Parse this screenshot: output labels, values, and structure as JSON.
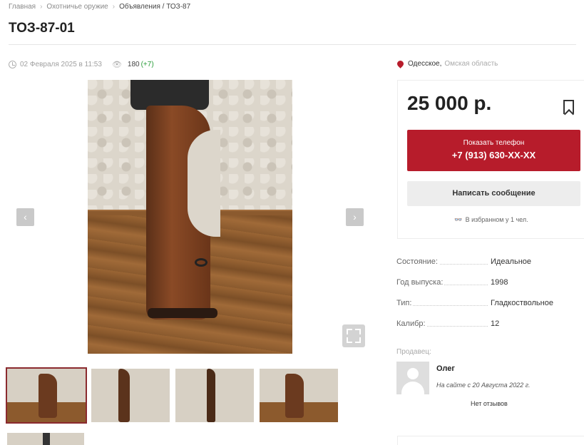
{
  "breadcrumbs": [
    "Главная",
    "Охотничье оружие",
    "Объявления / ТОЗ-87"
  ],
  "title": "ТОЗ-87-01",
  "meta": {
    "date": "02 Февраля 2025 в 11:53",
    "views": "180",
    "views_delta": "(+7)"
  },
  "gallery": {
    "prev_icon": "‹",
    "next_icon": "›"
  },
  "location": {
    "city": "Одесское,",
    "region": "Омская область"
  },
  "price_box": {
    "price": "25 000 р.",
    "phone_label": "Показать телефон",
    "phone_number": "+7 (913) 630-XX-XX",
    "message_label": "Написать сообщение",
    "favorites": "В избранном у 1 чел."
  },
  "specs": [
    {
      "key": "Состояние:",
      "value": "Идеальное"
    },
    {
      "key": "Год выпуска:",
      "value": "1998"
    },
    {
      "key": "Тип:",
      "value": "Гладкоствольное"
    },
    {
      "key": "Калибр:",
      "value": "12"
    }
  ],
  "seller": {
    "label": "Продавец:",
    "name": "Олег",
    "since": "На сайте с 20 Августа 2022 г.",
    "reviews": "Нет отзывов"
  },
  "colors": {
    "accent": "#b71c2b",
    "views_delta": "#2a9d3a"
  }
}
